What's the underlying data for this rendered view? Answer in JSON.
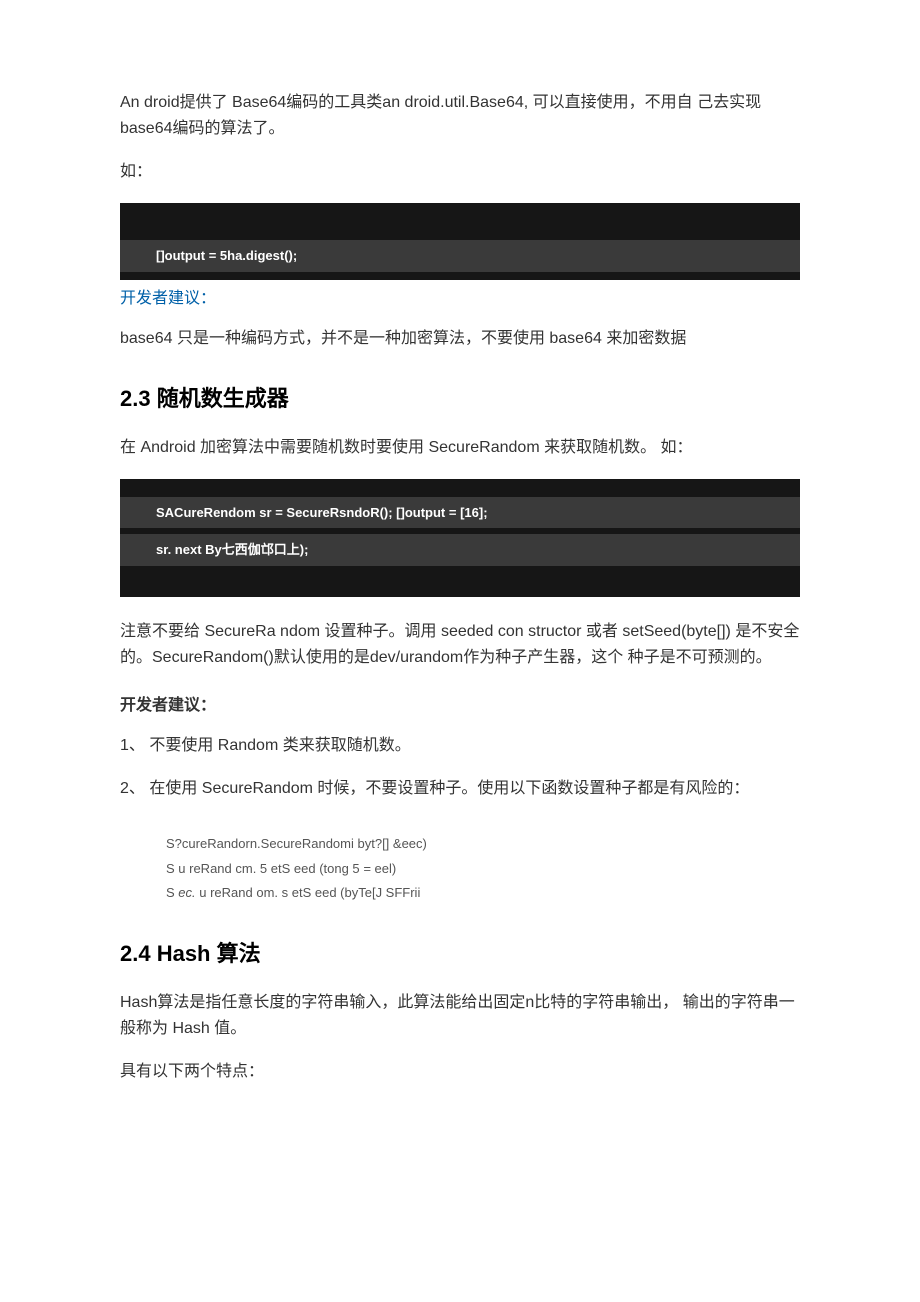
{
  "p1": "An droid提供了 Base64编码的工具类an droid.util.Base64, 可以直接使用，不用自 己去实现base64编码的算法了。",
  "p2": "如：",
  "code1": {
    "line1": "[]output = 5ha.digest();"
  },
  "devtip1": "开发者建议：",
  "p3": "base64 只是一种编码方式，并不是一种加密算法，不要使用 base64 来加密数据",
  "h23": "2.3 随机数生成器",
  "p4": "在 Android 加密算法中需要随机数时要使用 SecureRandom 来获取随机数。 如：",
  "code2": {
    "line1": "SACureRendom sr = SecureRsndoR(); []output =        [16];",
    "line2": "sr. next By七西伽邙口上);"
  },
  "p5": "注意不要给 SecureRa ndom 设置种子。调用 seeded con structor 或者 setSeed(byte[]) 是不安全的。SecureRandom()默认使用的是dev/urandom作为种子产生器，这个 种子是不可预测的。",
  "devtip2": "开发者建议：",
  "p6": "1、 不要使用 Random 类来获取随机数。",
  "p7": "2、 在使用 SecureRandom 时候，不要设置种子。使用以下函数设置种子都是有风险的：",
  "mono": {
    "l1": "S?cureRandorn.SecureRandomi byt?[] &eec)",
    "l2_pre": "S u reRand cm. 5 etS eed (tong 5 ",
    "l2_em": "=",
    "l2_post": " eel)",
    "l3_pre": "S ",
    "l3_em": "ec.",
    "l3_post": " u reRand om. s etS eed (byTe[J SFFrii"
  },
  "h24": "2.4 Hash 算法",
  "p8": "Hash算法是指任意长度的字符串输入，此算法能给出固定n比特的字符串输出， 输出的字符串一般称为 Hash 值。",
  "p9": "具有以下两个特点："
}
